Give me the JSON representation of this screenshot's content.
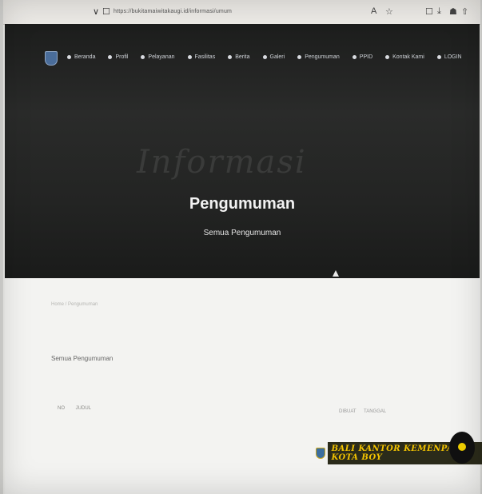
{
  "browser": {
    "url": "https://bukitamaiwitakaugi.id/informasi/umum",
    "back_glyph": "∨",
    "tab_glyph": "☐",
    "right_icons": [
      "A",
      "☆",
      "☐",
      "⤓",
      "☗",
      "⇧"
    ]
  },
  "nav": {
    "items": [
      "Beranda",
      "Profil",
      "Pelayanan",
      "Fasilitas",
      "Berita",
      "Galeri",
      "Pengumuman",
      "PPID",
      "Kontak Kami",
      "LOGIN"
    ]
  },
  "hero": {
    "watermark": "Informasi",
    "title": "Pengumuman",
    "subtitle": "Semua Pengumuman"
  },
  "content": {
    "breadcrumb": "Home / Pengumuman",
    "section_title": "Semua Pengumuman",
    "table_headers": [
      "NO",
      "JUDUL"
    ],
    "table_headers_right": "DIBUAT TANGGAL"
  },
  "banner": {
    "text": "BALI KANTOR KEMENPAN KOTA BOY"
  }
}
